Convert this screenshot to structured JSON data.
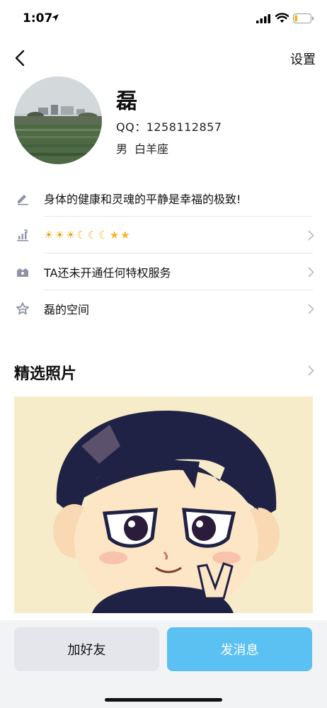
{
  "status_bar": {
    "time": "1:07"
  },
  "nav": {
    "settings_label": "设置"
  },
  "profile": {
    "nickname": "磊",
    "qq": "QQ：1258112857",
    "gender": "男",
    "zodiac": "白羊座"
  },
  "info_rows": [
    {
      "icon": "pencil-icon",
      "text": "身体的健康和灵魂的平静是幸福的极致!"
    },
    {
      "icon": "level-chart-icon",
      "badges": [
        "☀",
        "☀",
        "☀",
        "☾",
        "☾",
        "☾",
        "★",
        "★"
      ]
    },
    {
      "icon": "crown-icon",
      "text": "TA还未开通任何特权服务"
    },
    {
      "icon": "star-icon",
      "text": "磊的空间"
    }
  ],
  "photos": {
    "title": "精选照片"
  },
  "actions": {
    "add_friend": "加好友",
    "send_message": "发消息"
  },
  "colors": {
    "primary_button": "#5bc0f2",
    "secondary_button": "#e4e6ec",
    "bottom_bar": "#f2f3f5",
    "icon_gray": "#8e93a6"
  }
}
